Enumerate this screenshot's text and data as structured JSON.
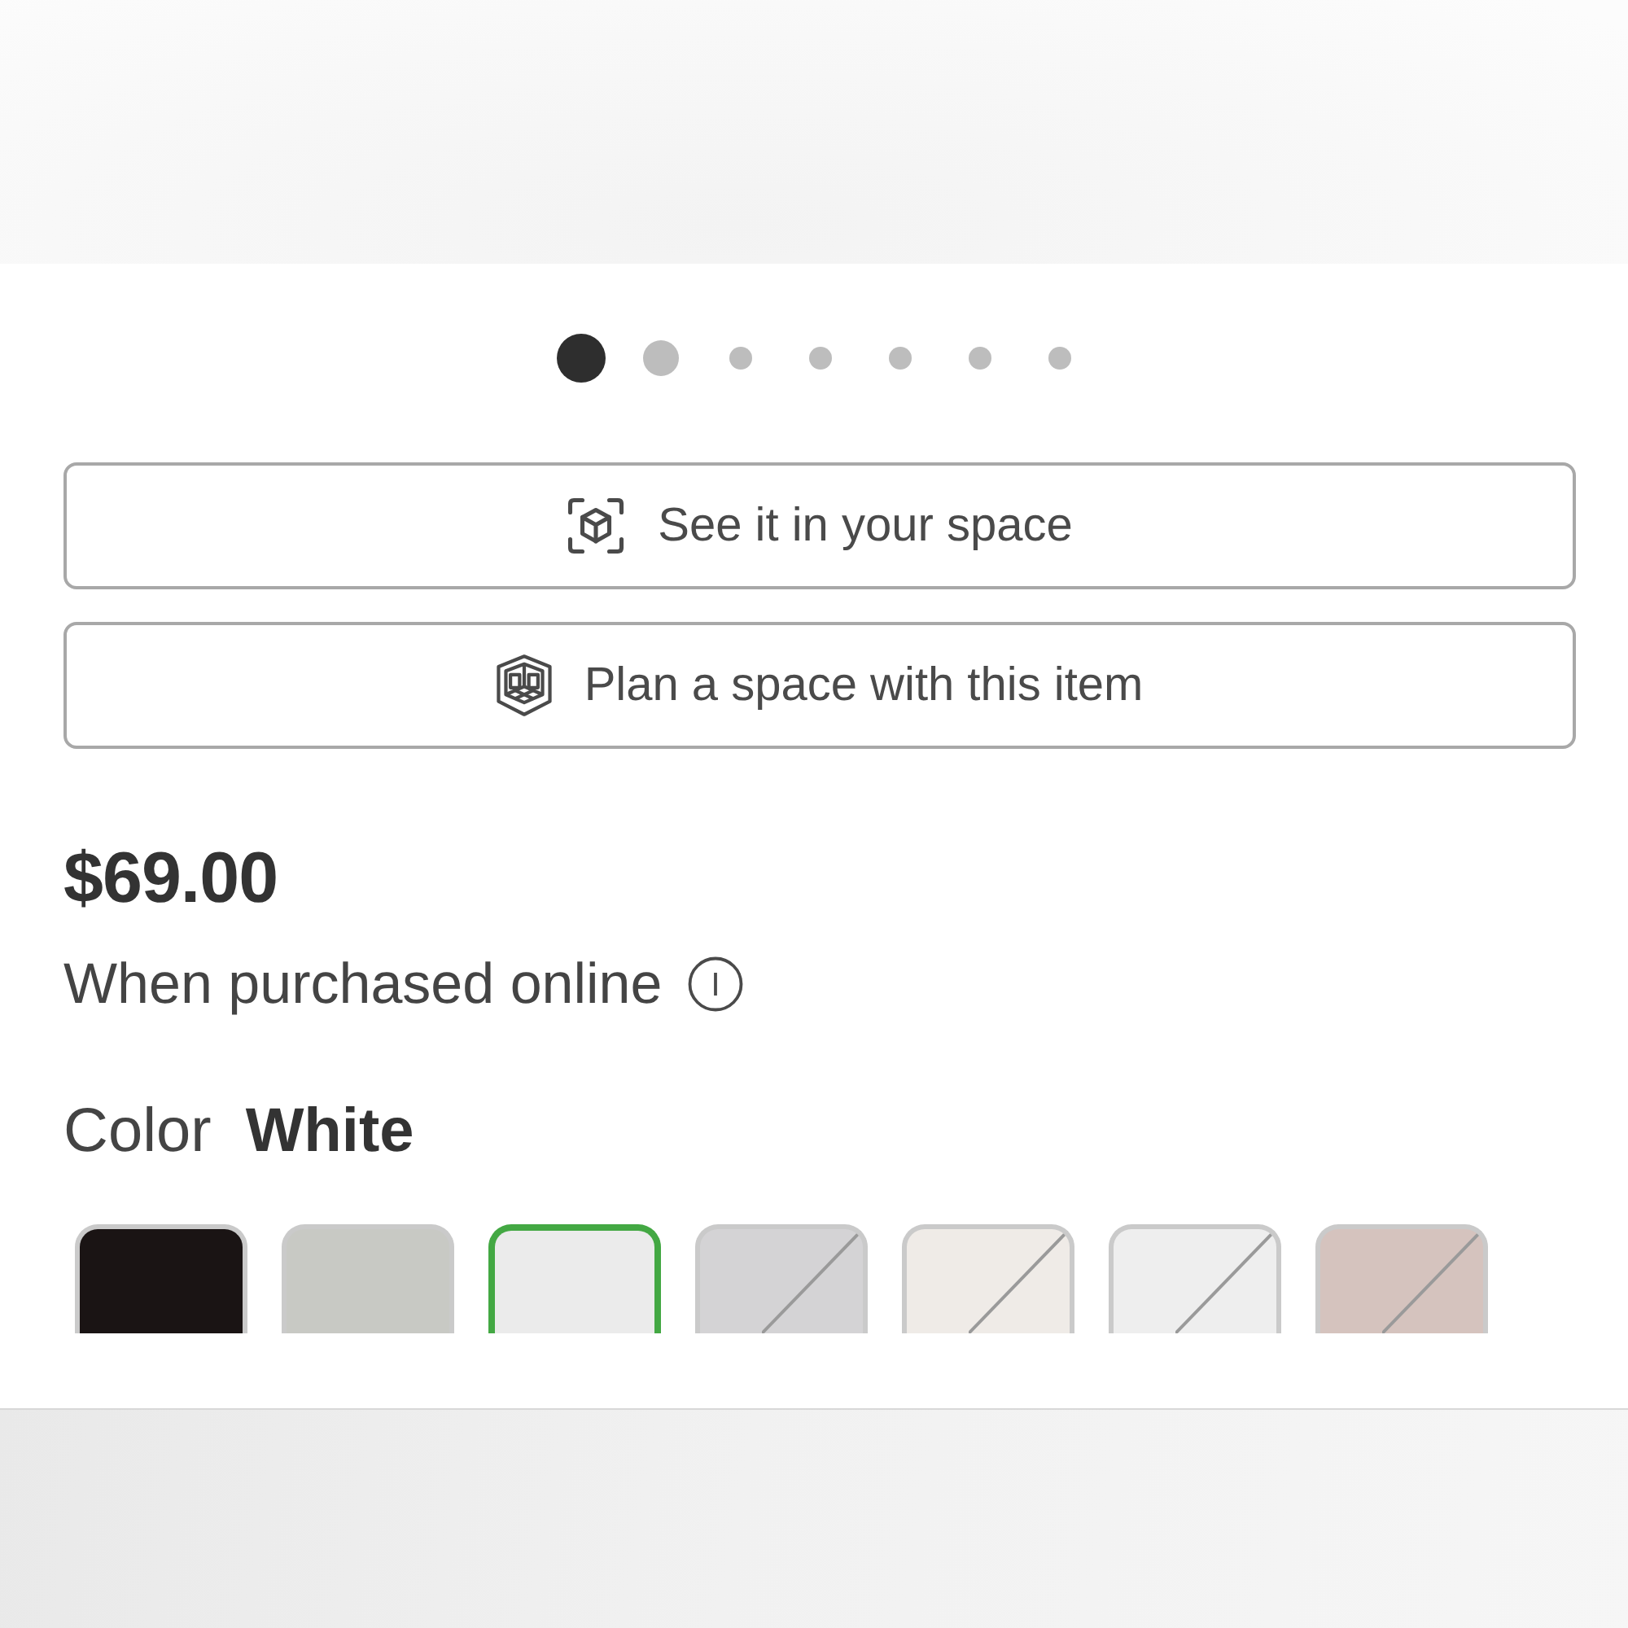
{
  "carousel": {
    "dots": [
      {
        "selected": true
      },
      {
        "selected": false
      },
      {
        "selected": false
      },
      {
        "selected": false
      },
      {
        "selected": false
      },
      {
        "selected": false
      },
      {
        "selected": false
      }
    ]
  },
  "actions": [
    {
      "kind": "ar",
      "label": "See it in your space"
    },
    {
      "kind": "plan",
      "label": "Plan a space with this item"
    }
  ],
  "price": {
    "amount": "$69.00",
    "note": "When purchased online"
  },
  "color": {
    "label": "Color",
    "value": "White"
  },
  "swatches": [
    {
      "color": "#1a1414",
      "selected": false,
      "unavailable": false
    },
    {
      "color": "#c8c9c4",
      "selected": false,
      "unavailable": false
    },
    {
      "color": "#ebebeb",
      "selected": true,
      "unavailable": false
    },
    {
      "color": "#d4d3d5",
      "selected": false,
      "unavailable": true
    },
    {
      "color": "#efebe7",
      "selected": false,
      "unavailable": true
    },
    {
      "color": "#eeeeee",
      "selected": false,
      "unavailable": true
    },
    {
      "color": "#d5c3be",
      "selected": false,
      "unavailable": true
    }
  ]
}
